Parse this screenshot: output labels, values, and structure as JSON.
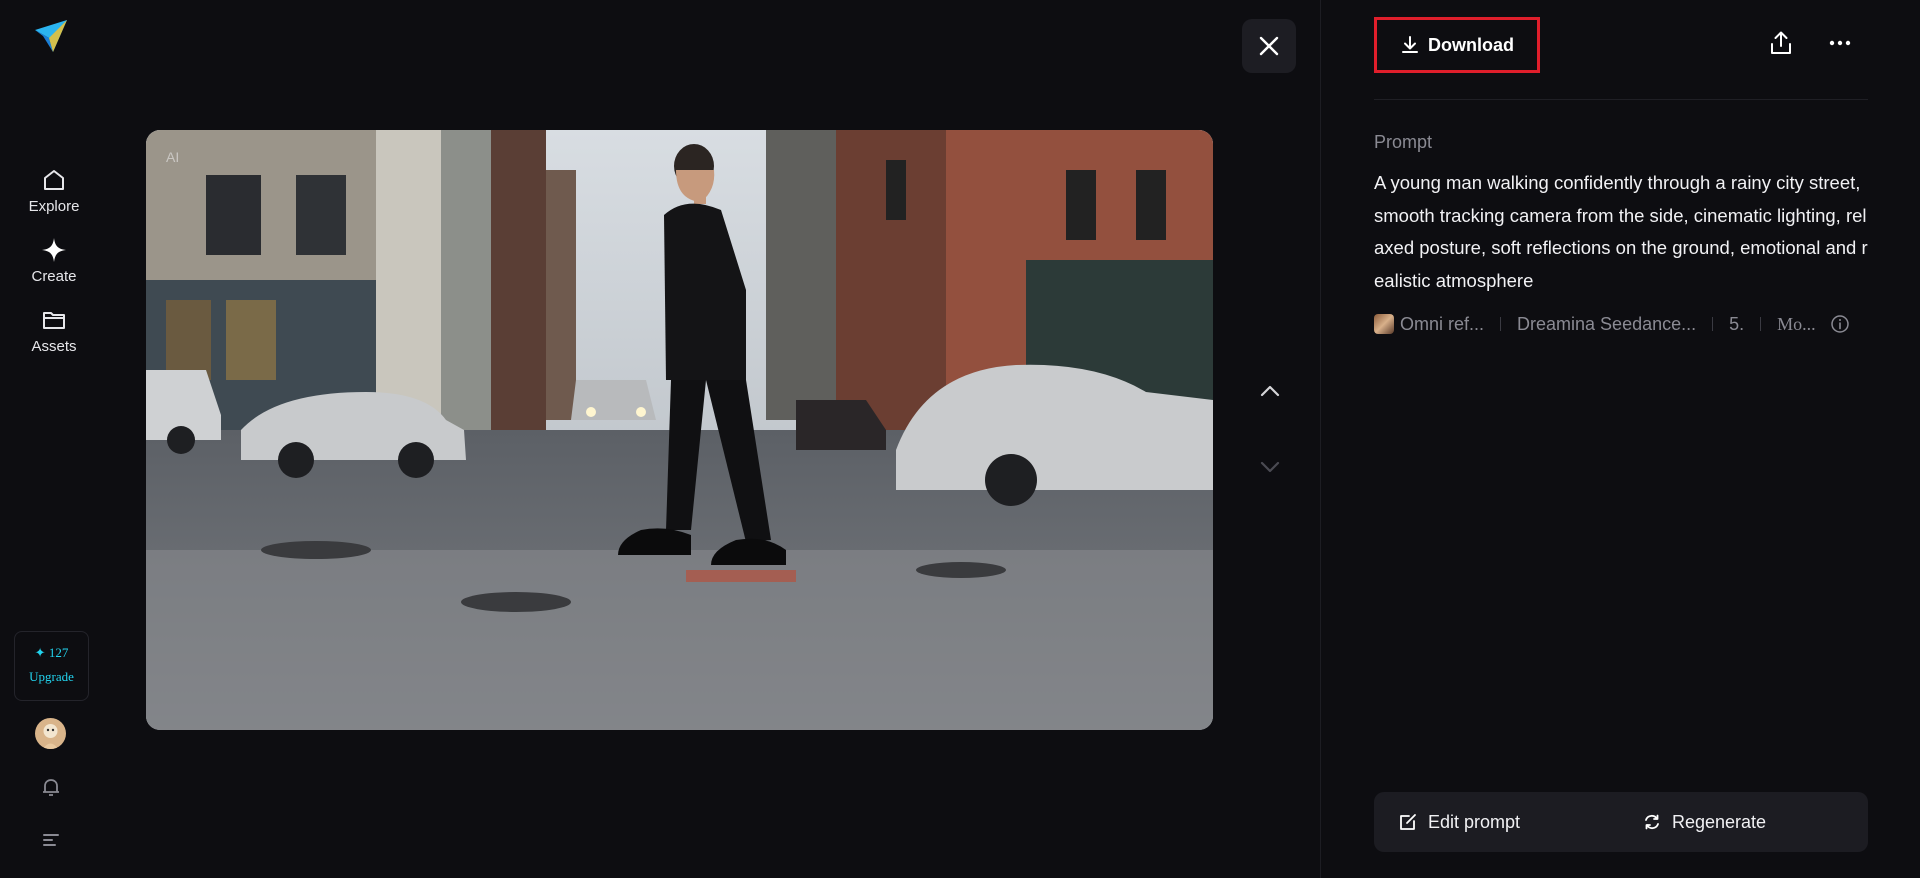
{
  "sidebar": {
    "logo": "paper-plane-logo",
    "nav": [
      {
        "label": "Explore",
        "icon": "home-icon"
      },
      {
        "label": "Create",
        "icon": "sparkle-icon"
      },
      {
        "label": "Assets",
        "icon": "folder-icon"
      }
    ],
    "credits": {
      "count": "✦ 127",
      "upgrade_label": "Upgrade"
    },
    "bell_icon": "bell-icon",
    "menu_icon": "menu-icon"
  },
  "viewer": {
    "watermark": "AI",
    "close_icon": "close-icon",
    "up_icon": "chevron-up-icon",
    "down_icon": "chevron-down-icon"
  },
  "panel": {
    "download_label": "Download",
    "share_icon": "share-icon",
    "more_icon": "more-icon",
    "prompt_label": "Prompt",
    "prompt_text": "A young man walking confidently through a rainy city street, smooth tracking camera from the side, cinematic lighting, relaxed posture, soft reflections on the ground, emotional and realistic atmosphere",
    "meta": {
      "reference": "Omni ref...",
      "model": "Dreamina Seedance...",
      "duration": "5.",
      "mode": "Mo..."
    },
    "edit_prompt_label": "Edit prompt",
    "regenerate_label": "Regenerate"
  },
  "colors": {
    "background": "#0d0d11",
    "accent": "#22d3ee",
    "highlight": "#e01e2b"
  }
}
